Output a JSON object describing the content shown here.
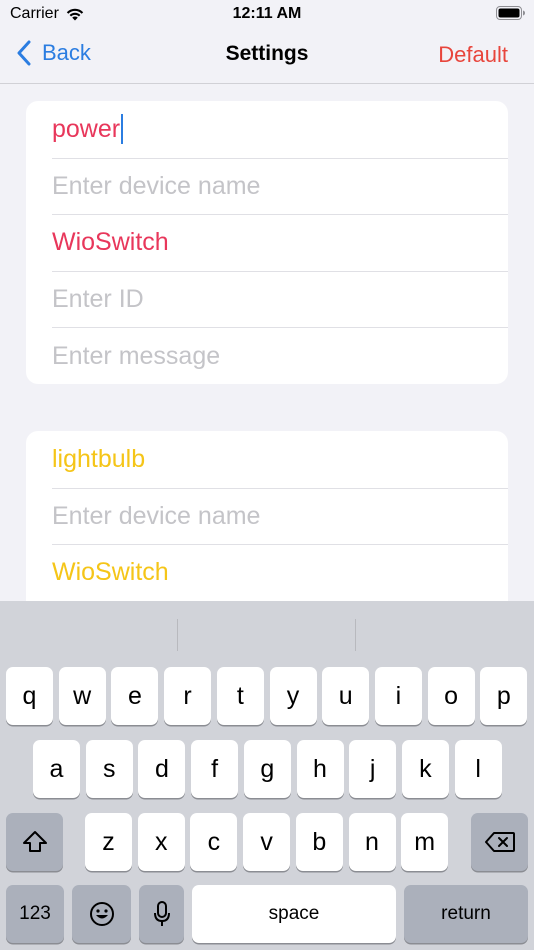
{
  "status_bar": {
    "carrier": "Carrier",
    "time": "12:11 AM",
    "icons": [
      "wifi-icon",
      "battery-icon"
    ]
  },
  "nav": {
    "back_label": "Back",
    "title": "Settings",
    "default_label": "Default"
  },
  "card1": {
    "name_value": "power",
    "device_name_placeholder": "Enter device name",
    "switch_value": "WioSwitch",
    "id_placeholder": "Enter ID",
    "message_placeholder": "Enter message"
  },
  "card2": {
    "name_value": "lightbulb",
    "device_name_placeholder": "Enter device name",
    "switch_value": "WioSwitch"
  },
  "colors": {
    "accent_blue": "#2b7de1",
    "default_red": "#e8453c",
    "card1_text": "#e8375b",
    "card2_text": "#f5c518"
  },
  "keyboard": {
    "row1": [
      "q",
      "w",
      "e",
      "r",
      "t",
      "y",
      "u",
      "i",
      "o",
      "p"
    ],
    "row2": [
      "a",
      "s",
      "d",
      "f",
      "g",
      "h",
      "j",
      "k",
      "l"
    ],
    "row3": [
      "z",
      "x",
      "c",
      "v",
      "b",
      "n",
      "m"
    ],
    "numbers_label": "123",
    "space_label": "space",
    "return_label": "return",
    "icons": [
      "shift-icon",
      "delete-icon",
      "emoji-icon",
      "microphone-icon"
    ]
  }
}
